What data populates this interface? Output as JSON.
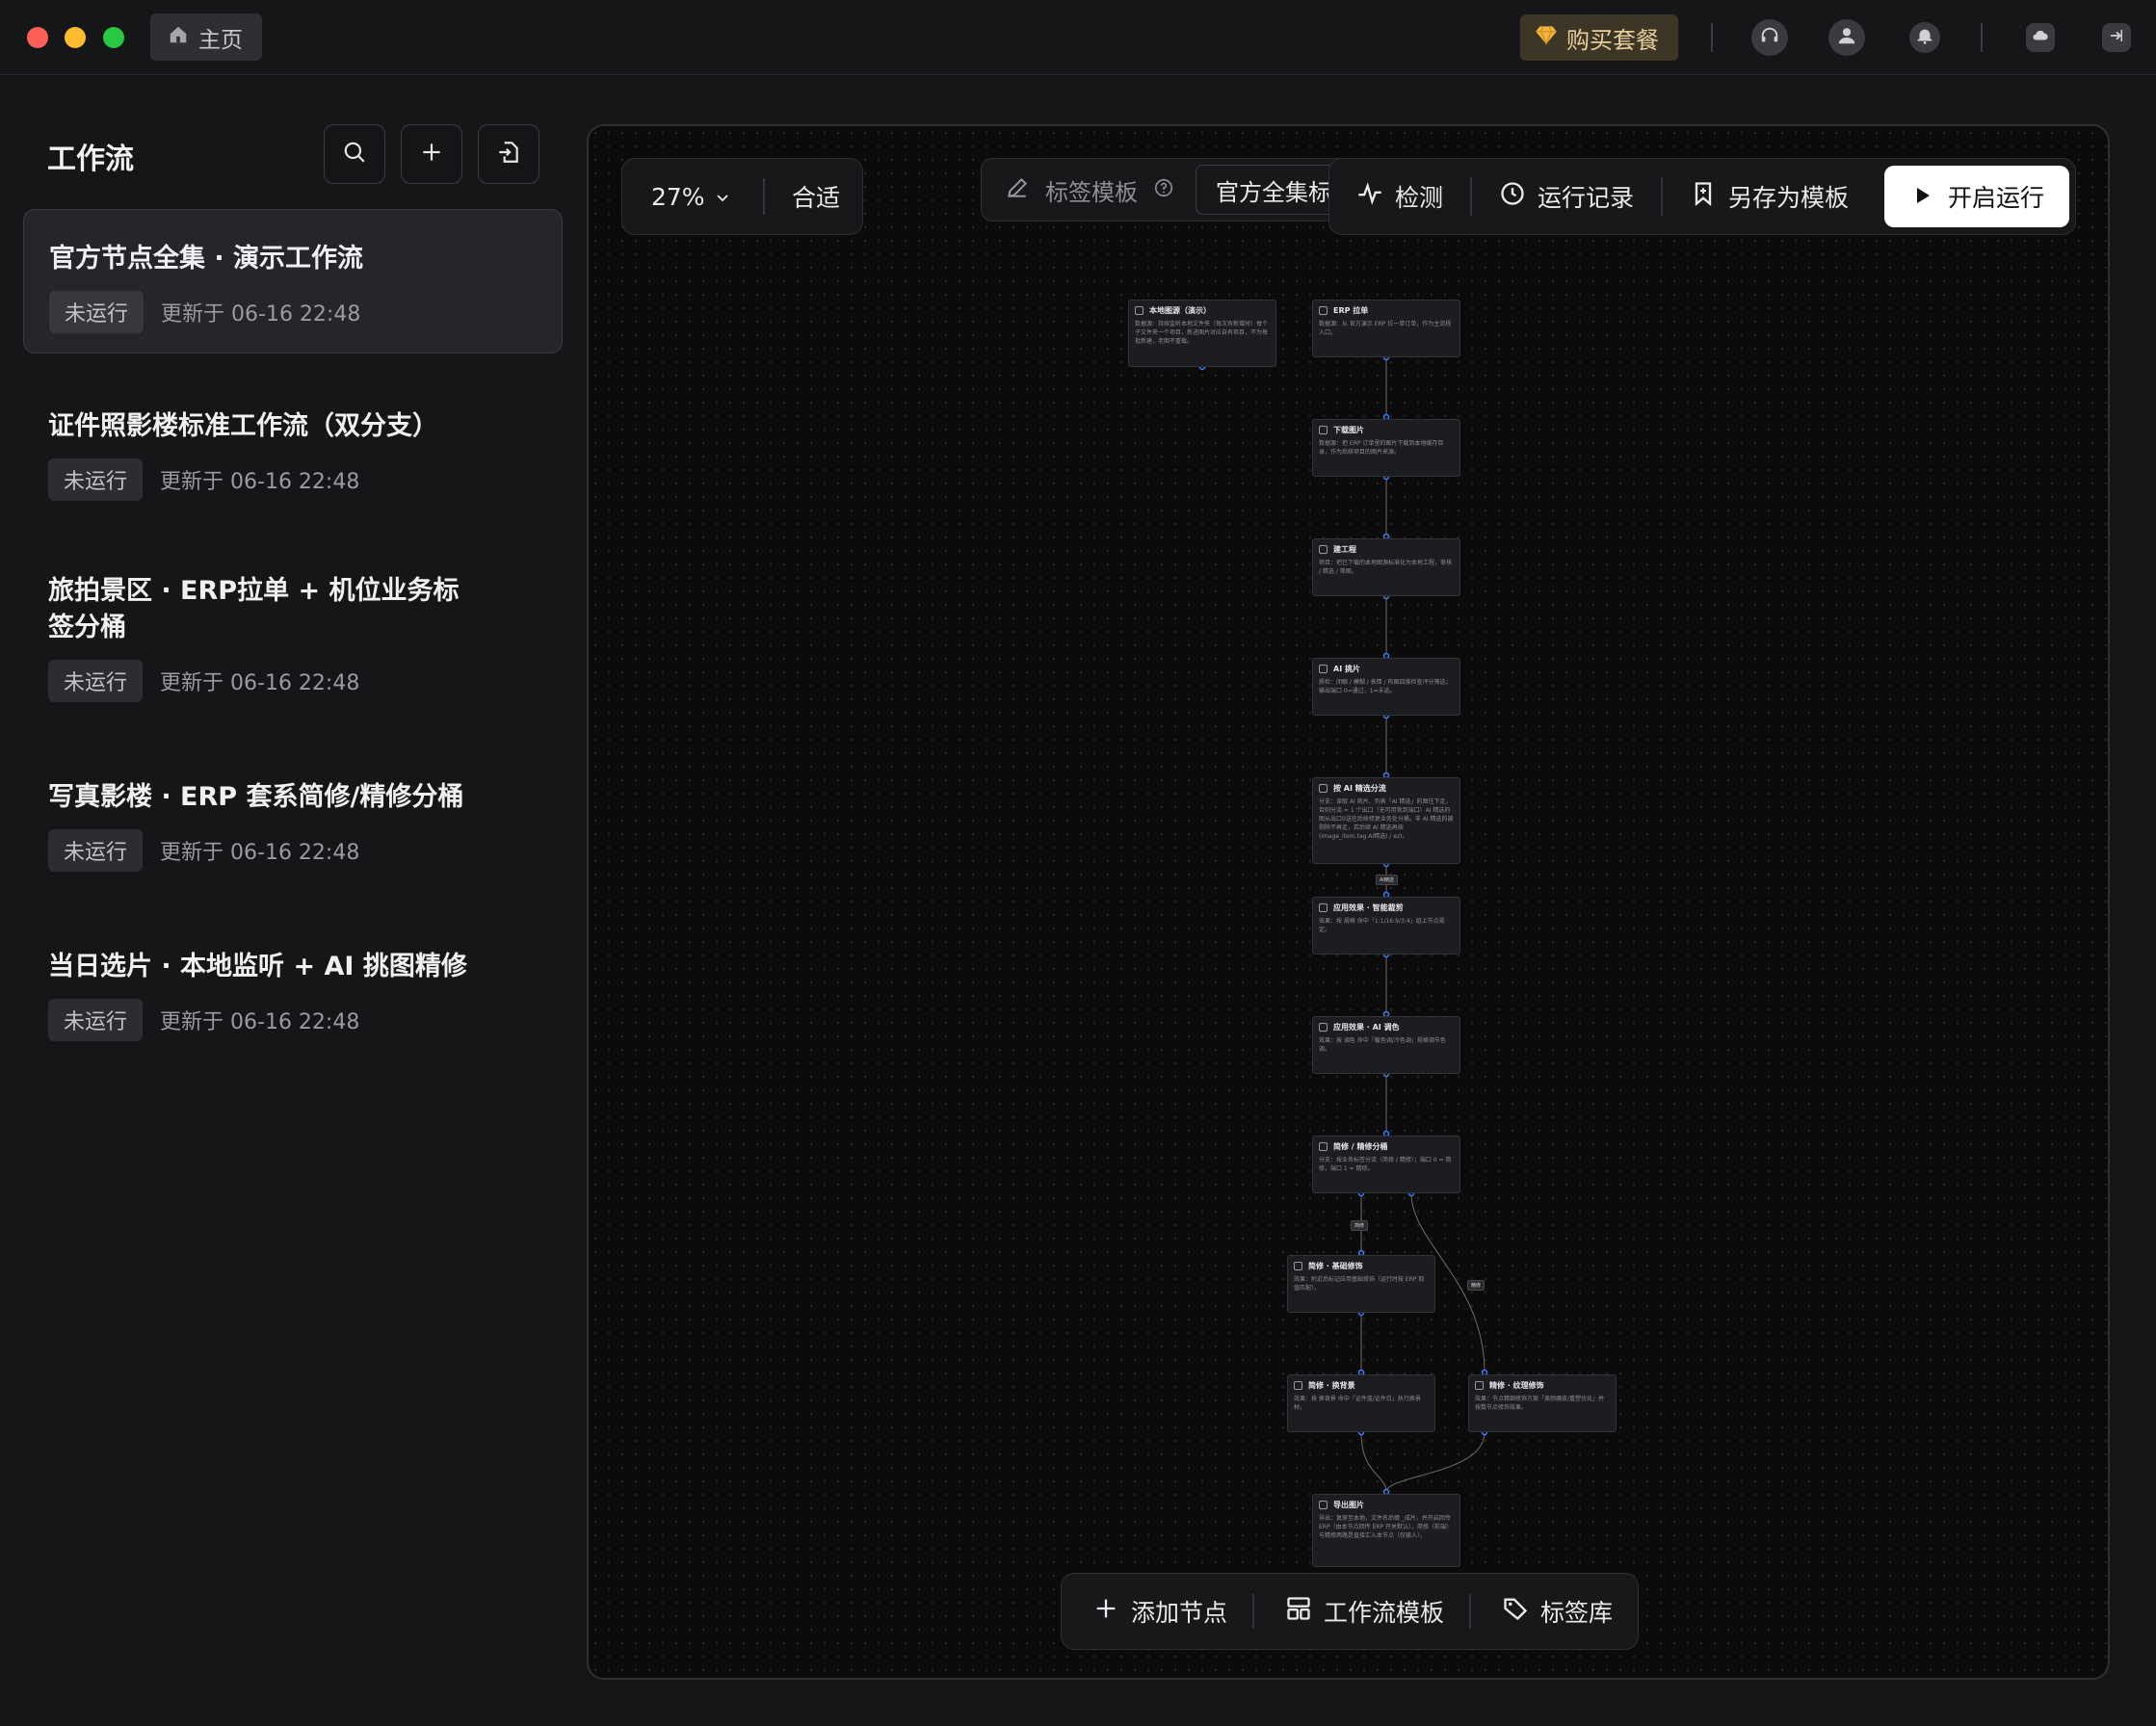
{
  "titlebar": {
    "home_tab": "主页",
    "buy_label": "购买套餐"
  },
  "sidebar": {
    "title": "工作流",
    "items": [
      {
        "title": "官方节点全集 · 演示工作流",
        "status": "未运行",
        "updated": "更新于 06-16 22:48"
      },
      {
        "title": "证件照影楼标准工作流（双分支）",
        "status": "未运行",
        "updated": "更新于 06-16 22:48"
      },
      {
        "title": "旅拍景区 · ERP拉单 + 机位业务标签分桶",
        "status": "未运行",
        "updated": "更新于 06-16 22:48"
      },
      {
        "title": "写真影楼 · ERP 套系简修/精修分桶",
        "status": "未运行",
        "updated": "更新于 06-16 22:48"
      },
      {
        "title": "当日选片 · 本地监听 + AI 挑图精修",
        "status": "未运行",
        "updated": "更新于 06-16 22:48"
      }
    ]
  },
  "canvas": {
    "zoom": "27%",
    "fit_label": "合适",
    "tag_template_label": "标签模板",
    "tag_template_value": "官方全集标签",
    "actions": {
      "check": "检测",
      "history": "运行记录",
      "save_template": "另存为模板",
      "run": "开启运行"
    },
    "bottom": {
      "add_node": "添加节点",
      "workflow_template": "工作流模板",
      "tag_library": "标签库"
    }
  },
  "graph": {
    "nodes": [
      {
        "title": "本地图源（演示）",
        "desc": "数据源：持续监听本地文件夹（每次有新增时）每个子文件夹一个项目，新进图片对应自有项目，不为每批新建，老图不重载。"
      },
      {
        "title": "ERP 拉单",
        "desc": "数据源：从 官方演示 ERP 拉一单订单，作为主流程入口。"
      },
      {
        "title": "下载图片",
        "desc": "数据源：把 ERP 订单里的图片下载到本地缓存目录，作为后续项目的图片来源。"
      },
      {
        "title": "建工程",
        "desc": "项目：把已下载的本地图源标准化为本地工程，审核 / 精选 / 筛图。"
      },
      {
        "title": "AI 挑片",
        "desc": "质检：闭眼 / 模糊 / 表情 / 构图四维检查评分筛选；输出端口 0=通过，1=未选。"
      },
      {
        "title": "按 AI 精选分流",
        "desc": "分支：读取 AI 挑片、列表「AI 精选」的图往下走，否则分流 = 1 个出口（无可用就到端口）AI 精选的图从出口0送往后续修复业务处分桶。非 AI 精选的被剔除不再走，若后续 AI 精选再按 (image_item.tag.AI精选) / ez)。"
      },
      {
        "title": "应用效果 · 智能裁剪",
        "desc": "效果：按 规格 命中「1:1/16:9/3:4」组上节点规定。"
      },
      {
        "title": "应用效果 · AI 调色",
        "desc": "效果：按 调色 命中「暖色调/冷色调」规格调节色调。"
      },
      {
        "title": "简修 / 精修分桶",
        "desc": "分支：按业务标签分流（简修 / 精修）；端口 0 = 简修，端口 1 = 精修。"
      },
      {
        "title": "简修 · 基础修饰",
        "desc": "效果：附近后标记应用基础修饰（运行时按 ERP 取值匹配）。"
      },
      {
        "title": "简修 · 换背景",
        "desc": "效果：按 换背景 命中「证件蓝/证件白」执行换景材。"
      },
      {
        "title": "精修 · 纹理修饰",
        "desc": "效果：节点精细修饰方案「美颜磨皮/重塑优化」并按数节点修饰效果。"
      },
      {
        "title": "导出图片",
        "desc": "导出：复原至本地，文件名后缀 _成片，并开启回传 ERP（由本节点回传 ERP 开关默认），简修（前端）与精修两路是直接汇入本节点（仅输入）。"
      }
    ],
    "edge_labels": {
      "ai_pick": "AI精选",
      "branch_1": "简修",
      "branch_2": "精修"
    }
  }
}
